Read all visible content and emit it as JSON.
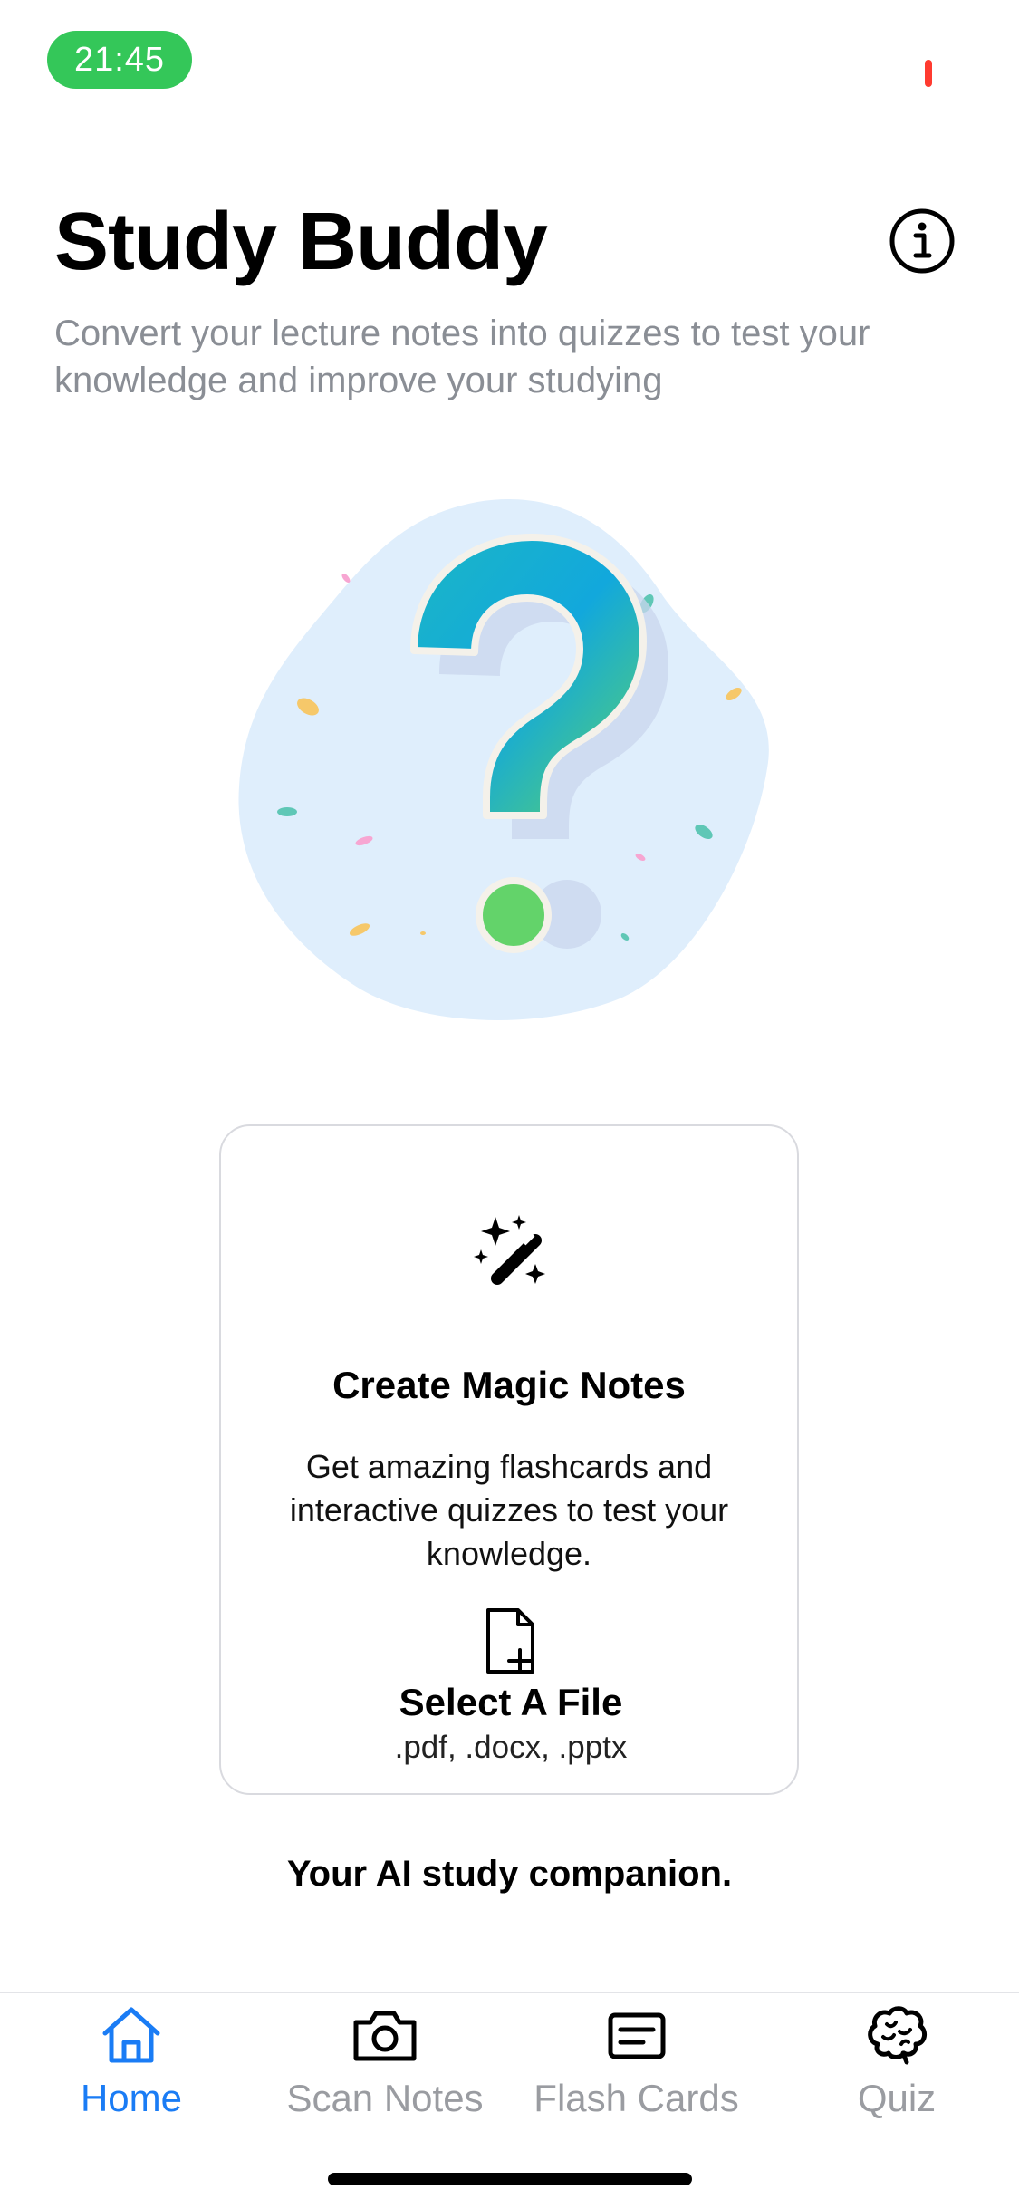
{
  "status_bar": {
    "time": "21:45"
  },
  "header": {
    "title": "Study Buddy",
    "subtitle": "Convert your lecture notes into quizzes to test your knowledge and improve your studying",
    "info_icon": "info-circle-icon"
  },
  "hero": {
    "icon": "question-mark-icon"
  },
  "card": {
    "icon": "magic-wand-icon",
    "title": "Create Magic Notes",
    "description": "Get amazing flashcards and interactive quizzes to test your knowledge.",
    "select_label": "Select A File",
    "file_types": ".pdf, .docx, .pptx",
    "file_icon": "file-plus-icon"
  },
  "tagline": "Your AI study companion.",
  "tabs": [
    {
      "label": "Home",
      "icon": "house-icon",
      "active": true
    },
    {
      "label": "Scan Notes",
      "icon": "camera-icon",
      "active": false
    },
    {
      "label": "Flash Cards",
      "icon": "card-lines-icon",
      "active": false
    },
    {
      "label": "Quiz",
      "icon": "brain-icon",
      "active": false
    }
  ],
  "colors": {
    "accent": "#1a7cf5",
    "status_pill": "#34c759",
    "inactive_tab": "#9a9ca1",
    "subtitle": "#8a8e95"
  }
}
